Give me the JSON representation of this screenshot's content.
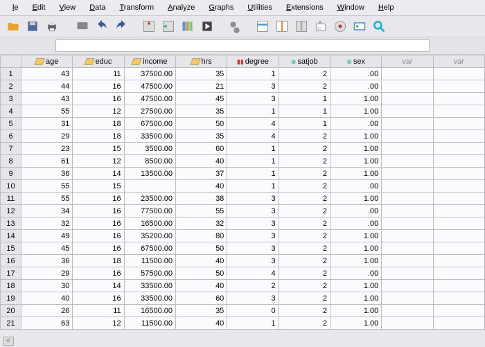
{
  "menu": [
    "le",
    "Edit",
    "View",
    "Data",
    "Transform",
    "Analyze",
    "Graphs",
    "Utilities",
    "Extensions",
    "Window",
    "Help"
  ],
  "columns": [
    {
      "name": "age",
      "type": "scale"
    },
    {
      "name": "educ",
      "type": "scale"
    },
    {
      "name": "income",
      "type": "scale"
    },
    {
      "name": "hrs",
      "type": "scale"
    },
    {
      "name": "degree",
      "type": "ordinal"
    },
    {
      "name": "satjob",
      "type": "nominal"
    },
    {
      "name": "sex",
      "type": "nominal"
    },
    {
      "name": "var",
      "type": "blank"
    },
    {
      "name": "var",
      "type": "blank"
    }
  ],
  "rows": [
    {
      "n": 1,
      "age": 43,
      "educ": 11,
      "income": "37500.00",
      "hrs": 35,
      "degree": 1,
      "satjob": 2,
      "sex": ".00"
    },
    {
      "n": 2,
      "age": 44,
      "educ": 16,
      "income": "47500.00",
      "hrs": 21,
      "degree": 3,
      "satjob": 2,
      "sex": ".00"
    },
    {
      "n": 3,
      "age": 43,
      "educ": 16,
      "income": "47500.00",
      "hrs": 45,
      "degree": 3,
      "satjob": 1,
      "sex": "1.00"
    },
    {
      "n": 4,
      "age": 55,
      "educ": 12,
      "income": "27500.00",
      "hrs": 35,
      "degree": 1,
      "satjob": 1,
      "sex": "1.00"
    },
    {
      "n": 5,
      "age": 31,
      "educ": 18,
      "income": "67500.00",
      "hrs": 50,
      "degree": 4,
      "satjob": 1,
      "sex": ".00"
    },
    {
      "n": 6,
      "age": 29,
      "educ": 18,
      "income": "33500.00",
      "hrs": 35,
      "degree": 4,
      "satjob": 2,
      "sex": "1.00"
    },
    {
      "n": 7,
      "age": 23,
      "educ": 15,
      "income": "3500.00",
      "hrs": 60,
      "degree": 1,
      "satjob": 2,
      "sex": "1.00"
    },
    {
      "n": 8,
      "age": 61,
      "educ": 12,
      "income": "8500.00",
      "hrs": 40,
      "degree": 1,
      "satjob": 2,
      "sex": "1.00"
    },
    {
      "n": 9,
      "age": 36,
      "educ": 14,
      "income": "13500.00",
      "hrs": 37,
      "degree": 1,
      "satjob": 2,
      "sex": "1.00"
    },
    {
      "n": 10,
      "age": 55,
      "educ": 15,
      "income": "",
      "hrs": 40,
      "degree": 1,
      "satjob": 2,
      "sex": ".00"
    },
    {
      "n": 11,
      "age": 55,
      "educ": 16,
      "income": "23500.00",
      "hrs": 38,
      "degree": 3,
      "satjob": 2,
      "sex": "1.00"
    },
    {
      "n": 12,
      "age": 34,
      "educ": 16,
      "income": "77500.00",
      "hrs": 55,
      "degree": 3,
      "satjob": 2,
      "sex": ".00"
    },
    {
      "n": 13,
      "age": 32,
      "educ": 16,
      "income": "16500.00",
      "hrs": 32,
      "degree": 3,
      "satjob": 2,
      "sex": ".00"
    },
    {
      "n": 14,
      "age": 49,
      "educ": 16,
      "income": "35200.00",
      "hrs": 80,
      "degree": 3,
      "satjob": 2,
      "sex": "1.00"
    },
    {
      "n": 15,
      "age": 45,
      "educ": 16,
      "income": "67500.00",
      "hrs": 50,
      "degree": 3,
      "satjob": 2,
      "sex": "1.00"
    },
    {
      "n": 16,
      "age": 36,
      "educ": 18,
      "income": "11500.00",
      "hrs": 40,
      "degree": 3,
      "satjob": 2,
      "sex": "1.00"
    },
    {
      "n": 17,
      "age": 29,
      "educ": 16,
      "income": "57500.00",
      "hrs": 50,
      "degree": 4,
      "satjob": 2,
      "sex": ".00"
    },
    {
      "n": 18,
      "age": 30,
      "educ": 14,
      "income": "33500.00",
      "hrs": 40,
      "degree": 2,
      "satjob": 2,
      "sex": "1.00"
    },
    {
      "n": 19,
      "age": 40,
      "educ": 16,
      "income": "33500.00",
      "hrs": 60,
      "degree": 3,
      "satjob": 2,
      "sex": "1.00"
    },
    {
      "n": 20,
      "age": 26,
      "educ": 11,
      "income": "16500.00",
      "hrs": 35,
      "degree": 0,
      "satjob": 2,
      "sex": "1.00"
    },
    {
      "n": 21,
      "age": 63,
      "educ": 12,
      "income": "11500.00",
      "hrs": 40,
      "degree": 1,
      "satjob": 2,
      "sex": "1.00"
    }
  ],
  "scroll_indicator": "<"
}
